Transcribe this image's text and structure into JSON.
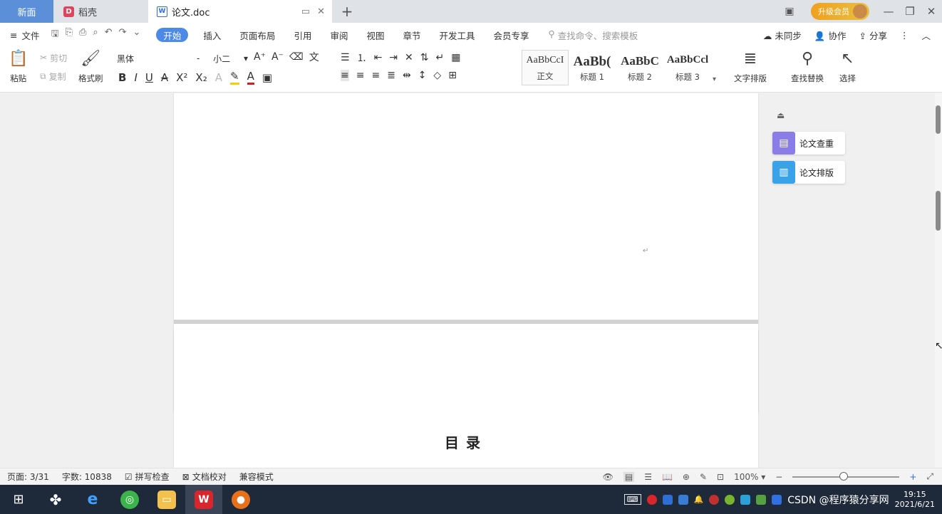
{
  "tabs": {
    "home": "新面",
    "daoke": "稻壳",
    "doc": "论文.doc",
    "add": "+"
  },
  "titlebar": {
    "vip_label": "升级会员"
  },
  "menu": {
    "file": "文件",
    "start": "开始",
    "items": [
      "插入",
      "页面布局",
      "引用",
      "审阅",
      "视图",
      "章节",
      "开发工具",
      "会员专享"
    ],
    "search_placeholder": "查找命令、搜索模板",
    "sync": "未同步",
    "collab": "协作",
    "share": "分享"
  },
  "ribbon": {
    "paste": "粘贴",
    "cut": "剪切",
    "copy": "复制",
    "format_painter": "格式刷",
    "font_name": "黑体",
    "font_size": "小二",
    "styles": [
      {
        "sample": "AaBbCcI",
        "name": "正文",
        "bold": false,
        "size": 14
      },
      {
        "sample": "AaBb(",
        "name": "标题 1",
        "bold": true,
        "size": 19
      },
      {
        "sample": "AaBbC",
        "name": "标题 2",
        "bold": true,
        "size": 17
      },
      {
        "sample": "AaBbCcl",
        "name": "标题 3",
        "bold": true,
        "size": 15
      }
    ],
    "text_layout": "文字排版",
    "find_replace": "查找替换",
    "select": "选择"
  },
  "document": {
    "toc_title": "目录",
    "paragraph_mark": "↵"
  },
  "side_panel": {
    "check": "论文查重",
    "layout": "论文排版"
  },
  "status": {
    "page": "页面: 3/31",
    "words": "字数: 10838",
    "spell": "拼写检查",
    "proofread": "文档校对",
    "compat": "兼容模式",
    "zoom": "100%"
  },
  "taskbar": {
    "tray_text": "CSDN @程序猿分享网",
    "time": "19:15",
    "date": "2021/6/21"
  },
  "colors": {
    "accent": "#4d8ae8",
    "check_icon": "#8a7de8",
    "layout_icon": "#3aa3e8",
    "taskbar": "#1e2a3a"
  }
}
